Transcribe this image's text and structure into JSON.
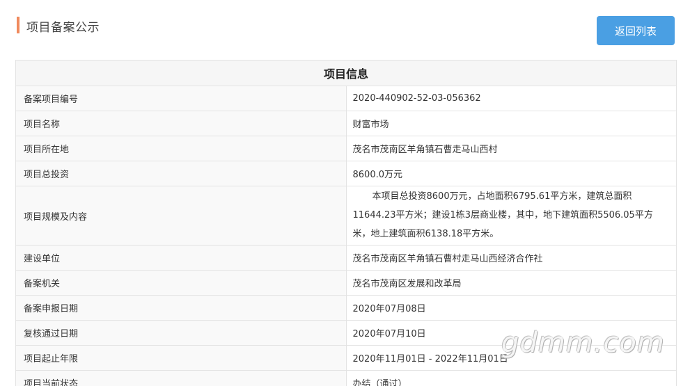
{
  "header": {
    "title": "项目备案公示",
    "back_button_label": "返回列表"
  },
  "table": {
    "heading": "项目信息",
    "rows": [
      {
        "label": "备案项目编号",
        "value": "2020-440902-52-03-056362"
      },
      {
        "label": "项目名称",
        "value": "财富市场"
      },
      {
        "label": "项目所在地",
        "value": "茂名市茂南区羊角镇石曹走马山西村"
      },
      {
        "label": "项目总投资",
        "value": "8600.0万元"
      },
      {
        "label": "项目规模及内容",
        "value": "本项目总投资8600万元，占地面积6795.61平方米，建筑总面积11644.23平方米；建设1栋3层商业楼，其中，地下建筑面积5506.05平方米，地上建筑面积6138.18平方米。"
      },
      {
        "label": "建设单位",
        "value": "茂名市茂南区羊角镇石曹村走马山西经济合作社"
      },
      {
        "label": "备案机关",
        "value": "茂名市茂南区发展和改革局"
      },
      {
        "label": "备案申报日期",
        "value": "2020年07月08日"
      },
      {
        "label": "复核通过日期",
        "value": "2020年07月10日"
      },
      {
        "label": "项目起止年限",
        "value": "2020年11月01日 - 2022年11月01日"
      },
      {
        "label": "项目当前状态",
        "value": "办结（通过）"
      }
    ]
  },
  "watermark": "gdmm.com",
  "colors": {
    "accent_bar": "#f08a5d",
    "button": "#4a9fe3"
  }
}
